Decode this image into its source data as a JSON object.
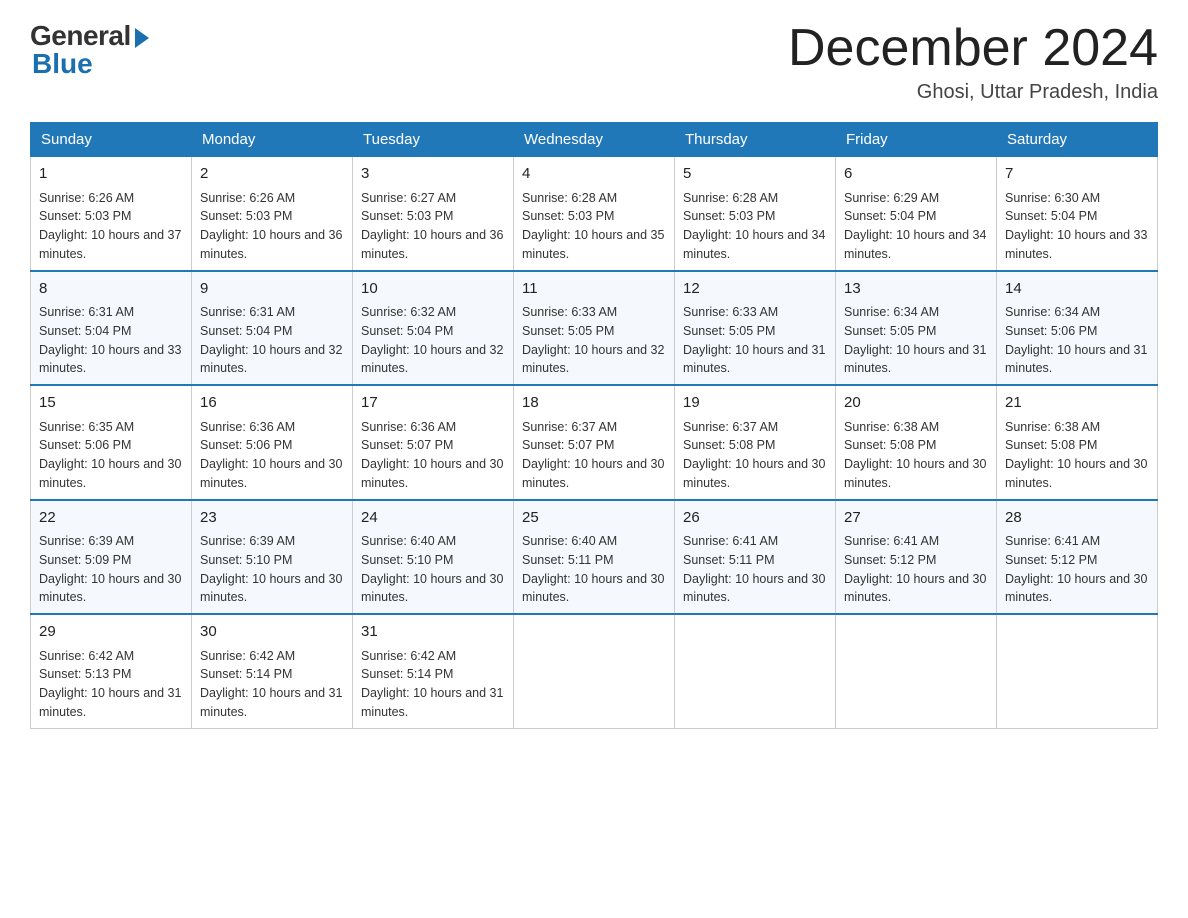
{
  "logo": {
    "general": "General",
    "blue": "Blue"
  },
  "title": "December 2024",
  "location": "Ghosi, Uttar Pradesh, India",
  "days_of_week": [
    "Sunday",
    "Monday",
    "Tuesday",
    "Wednesday",
    "Thursday",
    "Friday",
    "Saturday"
  ],
  "weeks": [
    [
      {
        "date": "1",
        "sunrise": "6:26 AM",
        "sunset": "5:03 PM",
        "daylight": "10 hours and 37 minutes."
      },
      {
        "date": "2",
        "sunrise": "6:26 AM",
        "sunset": "5:03 PM",
        "daylight": "10 hours and 36 minutes."
      },
      {
        "date": "3",
        "sunrise": "6:27 AM",
        "sunset": "5:03 PM",
        "daylight": "10 hours and 36 minutes."
      },
      {
        "date": "4",
        "sunrise": "6:28 AM",
        "sunset": "5:03 PM",
        "daylight": "10 hours and 35 minutes."
      },
      {
        "date": "5",
        "sunrise": "6:28 AM",
        "sunset": "5:03 PM",
        "daylight": "10 hours and 34 minutes."
      },
      {
        "date": "6",
        "sunrise": "6:29 AM",
        "sunset": "5:04 PM",
        "daylight": "10 hours and 34 minutes."
      },
      {
        "date": "7",
        "sunrise": "6:30 AM",
        "sunset": "5:04 PM",
        "daylight": "10 hours and 33 minutes."
      }
    ],
    [
      {
        "date": "8",
        "sunrise": "6:31 AM",
        "sunset": "5:04 PM",
        "daylight": "10 hours and 33 minutes."
      },
      {
        "date": "9",
        "sunrise": "6:31 AM",
        "sunset": "5:04 PM",
        "daylight": "10 hours and 32 minutes."
      },
      {
        "date": "10",
        "sunrise": "6:32 AM",
        "sunset": "5:04 PM",
        "daylight": "10 hours and 32 minutes."
      },
      {
        "date": "11",
        "sunrise": "6:33 AM",
        "sunset": "5:05 PM",
        "daylight": "10 hours and 32 minutes."
      },
      {
        "date": "12",
        "sunrise": "6:33 AM",
        "sunset": "5:05 PM",
        "daylight": "10 hours and 31 minutes."
      },
      {
        "date": "13",
        "sunrise": "6:34 AM",
        "sunset": "5:05 PM",
        "daylight": "10 hours and 31 minutes."
      },
      {
        "date": "14",
        "sunrise": "6:34 AM",
        "sunset": "5:06 PM",
        "daylight": "10 hours and 31 minutes."
      }
    ],
    [
      {
        "date": "15",
        "sunrise": "6:35 AM",
        "sunset": "5:06 PM",
        "daylight": "10 hours and 30 minutes."
      },
      {
        "date": "16",
        "sunrise": "6:36 AM",
        "sunset": "5:06 PM",
        "daylight": "10 hours and 30 minutes."
      },
      {
        "date": "17",
        "sunrise": "6:36 AM",
        "sunset": "5:07 PM",
        "daylight": "10 hours and 30 minutes."
      },
      {
        "date": "18",
        "sunrise": "6:37 AM",
        "sunset": "5:07 PM",
        "daylight": "10 hours and 30 minutes."
      },
      {
        "date": "19",
        "sunrise": "6:37 AM",
        "sunset": "5:08 PM",
        "daylight": "10 hours and 30 minutes."
      },
      {
        "date": "20",
        "sunrise": "6:38 AM",
        "sunset": "5:08 PM",
        "daylight": "10 hours and 30 minutes."
      },
      {
        "date": "21",
        "sunrise": "6:38 AM",
        "sunset": "5:08 PM",
        "daylight": "10 hours and 30 minutes."
      }
    ],
    [
      {
        "date": "22",
        "sunrise": "6:39 AM",
        "sunset": "5:09 PM",
        "daylight": "10 hours and 30 minutes."
      },
      {
        "date": "23",
        "sunrise": "6:39 AM",
        "sunset": "5:10 PM",
        "daylight": "10 hours and 30 minutes."
      },
      {
        "date": "24",
        "sunrise": "6:40 AM",
        "sunset": "5:10 PM",
        "daylight": "10 hours and 30 minutes."
      },
      {
        "date": "25",
        "sunrise": "6:40 AM",
        "sunset": "5:11 PM",
        "daylight": "10 hours and 30 minutes."
      },
      {
        "date": "26",
        "sunrise": "6:41 AM",
        "sunset": "5:11 PM",
        "daylight": "10 hours and 30 minutes."
      },
      {
        "date": "27",
        "sunrise": "6:41 AM",
        "sunset": "5:12 PM",
        "daylight": "10 hours and 30 minutes."
      },
      {
        "date": "28",
        "sunrise": "6:41 AM",
        "sunset": "5:12 PM",
        "daylight": "10 hours and 30 minutes."
      }
    ],
    [
      {
        "date": "29",
        "sunrise": "6:42 AM",
        "sunset": "5:13 PM",
        "daylight": "10 hours and 31 minutes."
      },
      {
        "date": "30",
        "sunrise": "6:42 AM",
        "sunset": "5:14 PM",
        "daylight": "10 hours and 31 minutes."
      },
      {
        "date": "31",
        "sunrise": "6:42 AM",
        "sunset": "5:14 PM",
        "daylight": "10 hours and 31 minutes."
      },
      null,
      null,
      null,
      null
    ]
  ]
}
